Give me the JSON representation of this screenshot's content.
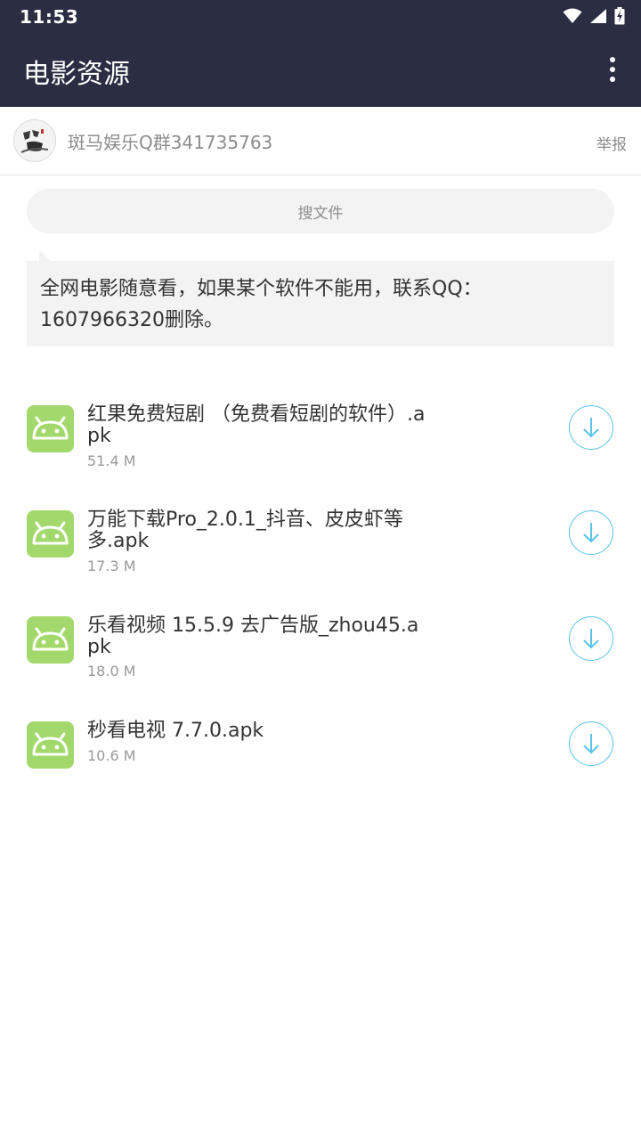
{
  "status_bar": {
    "time": "11:53"
  },
  "app_bar": {
    "title": "电影资源",
    "menu_icon": "more-vert-icon"
  },
  "group": {
    "name": "斑马娱乐Q群341735763",
    "report_label": "举报"
  },
  "search": {
    "label": "搜文件"
  },
  "notice": {
    "text": "全网电影随意看，如果某个软件不能用，联系QQ：1607966320删除。"
  },
  "files": [
    {
      "name": "红果免费短剧 （免费看短剧的软件）.apk",
      "size": "51.4 M"
    },
    {
      "name": "万能下载Pro_2.0.1_抖音、皮皮虾等多.apk",
      "size": "17.3 M"
    },
    {
      "name": "乐看视频 15.5.9 去广告版_zhou45.apk",
      "size": "18.0 M"
    },
    {
      "name": "秒看电视 7.7.0.apk",
      "size": "10.6 M"
    }
  ],
  "colors": {
    "app_bar": "#2b2e43",
    "apk_icon": "#a3d96c",
    "download_accent": "#5ac3ea"
  }
}
